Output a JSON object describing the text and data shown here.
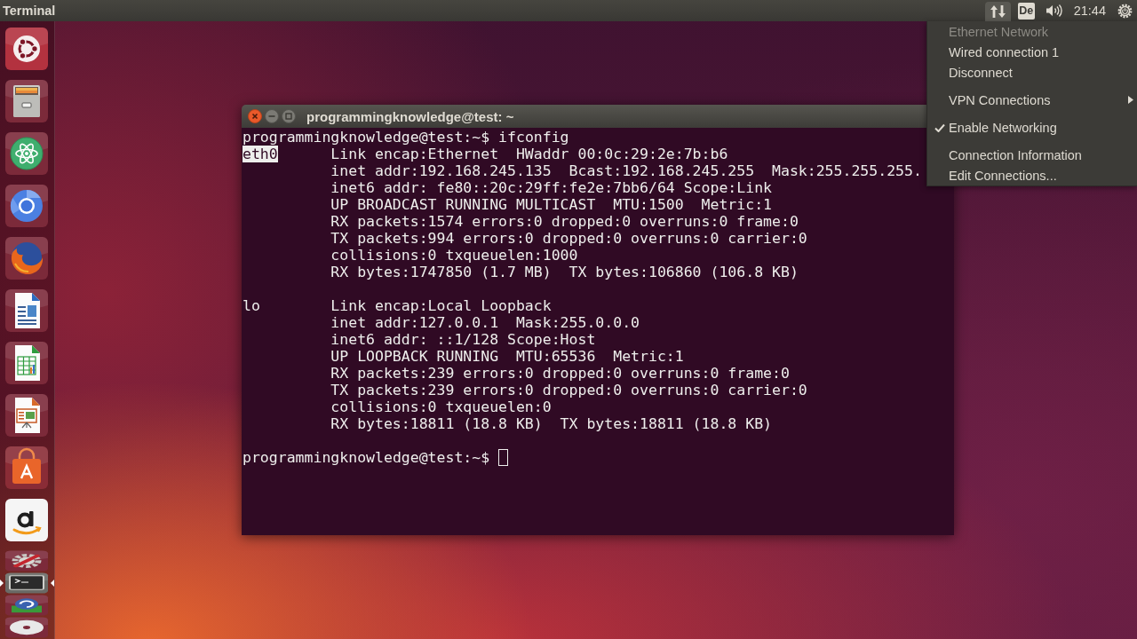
{
  "top_bar": {
    "app_title": "Terminal",
    "indicators": [
      {
        "kind": "network",
        "selected": true
      },
      {
        "kind": "keyboard",
        "label": "De",
        "selected": false
      },
      {
        "kind": "sound",
        "selected": false
      },
      {
        "kind": "clock",
        "label": "21:44",
        "selected": false
      },
      {
        "kind": "session",
        "selected": false
      }
    ]
  },
  "network_menu": {
    "sections": [
      {
        "items": [
          {
            "kind": "item",
            "label": "Ethernet Network",
            "disabled": true,
            "checked": false
          },
          {
            "kind": "item",
            "label": "Wired connection 1",
            "disabled": false,
            "checked": false
          },
          {
            "kind": "item",
            "label": "Disconnect",
            "disabled": false,
            "checked": false
          }
        ]
      },
      {
        "items": [
          {
            "kind": "submenu",
            "label": "VPN Connections",
            "disabled": false,
            "checked": false
          }
        ]
      },
      {
        "items": [
          {
            "kind": "item",
            "label": "Enable Networking",
            "disabled": false,
            "checked": true
          }
        ]
      },
      {
        "items": [
          {
            "kind": "item",
            "label": "Connection Information",
            "disabled": false,
            "checked": false
          },
          {
            "kind": "item",
            "label": "Edit Connections...",
            "disabled": false,
            "checked": false
          }
        ]
      }
    ]
  },
  "launcher": {
    "items": [
      {
        "kind": "dash",
        "running": false,
        "focused": false
      },
      {
        "kind": "files",
        "running": false,
        "focused": false
      },
      {
        "kind": "atom",
        "running": false,
        "focused": false
      },
      {
        "kind": "chromium",
        "running": false,
        "focused": false
      },
      {
        "kind": "firefox",
        "running": false,
        "focused": false
      },
      {
        "kind": "writer",
        "running": false,
        "focused": false
      },
      {
        "kind": "calc",
        "running": false,
        "focused": false
      },
      {
        "kind": "impress",
        "running": false,
        "focused": false
      },
      {
        "kind": "software",
        "running": false,
        "focused": false
      },
      {
        "kind": "amazon",
        "running": false,
        "focused": false
      }
    ],
    "folded_items": [
      {
        "kind": "settings",
        "running": false,
        "focused": false
      },
      {
        "kind": "terminal",
        "running": true,
        "focused": true
      },
      {
        "kind": "updater",
        "running": false,
        "focused": false
      },
      {
        "kind": "dvd",
        "running": false,
        "focused": false
      }
    ]
  },
  "terminal": {
    "title": "programmingknowledge@test: ~",
    "command_line": "programmingknowledge@test:~$ ifconfig",
    "interfaces": [
      {
        "name": "eth0",
        "highlighted": true,
        "lines": [
          "Link encap:Ethernet  HWaddr 00:0c:29:2e:7b:b6",
          "inet addr:192.168.245.135  Bcast:192.168.245.255  Mask:255.255.255.",
          "inet6 addr: fe80::20c:29ff:fe2e:7bb6/64 Scope:Link",
          "UP BROADCAST RUNNING MULTICAST  MTU:1500  Metric:1",
          "RX packets:1574 errors:0 dropped:0 overruns:0 frame:0",
          "TX packets:994 errors:0 dropped:0 overruns:0 carrier:0",
          "collisions:0 txqueuelen:1000",
          "RX bytes:1747850 (1.7 MB)  TX bytes:106860 (106.8 KB)"
        ]
      },
      {
        "name": "lo",
        "highlighted": false,
        "lines": [
          "Link encap:Local Loopback",
          "inet addr:127.0.0.1  Mask:255.0.0.0",
          "inet6 addr: ::1/128 Scope:Host",
          "UP LOOPBACK RUNNING  MTU:65536  Metric:1",
          "RX packets:239 errors:0 dropped:0 overruns:0 frame:0",
          "TX packets:239 errors:0 dropped:0 overruns:0 carrier:0",
          "collisions:0 txqueuelen:0",
          "RX bytes:18811 (18.8 KB)  TX bytes:18811 (18.8 KB)"
        ]
      }
    ],
    "prompt": "programmingknowledge@test:~$"
  }
}
